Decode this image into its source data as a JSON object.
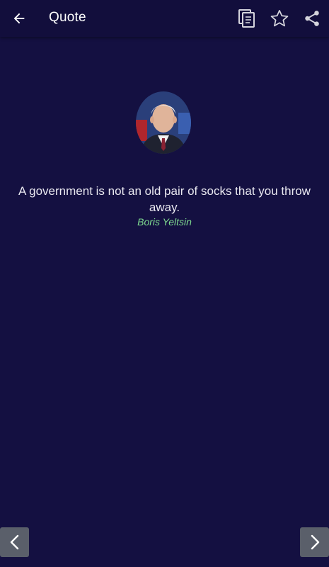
{
  "toolbar": {
    "title": "Quote",
    "icons": {
      "back": "arrow-back-icon",
      "copy": "copy-icon",
      "favorite": "star-outline-icon",
      "share": "share-icon"
    }
  },
  "quote": {
    "text": "A government is not an old pair of socks that you throw away.",
    "author": "Boris Yeltsin"
  },
  "navigation": {
    "previous_icon": "chevron-left-icon",
    "next_icon": "chevron-right-icon"
  },
  "colors": {
    "background": "#141041",
    "toolbar": "#120e3c",
    "author": "#7ed98f",
    "nav_button": "#5a5f6a"
  }
}
